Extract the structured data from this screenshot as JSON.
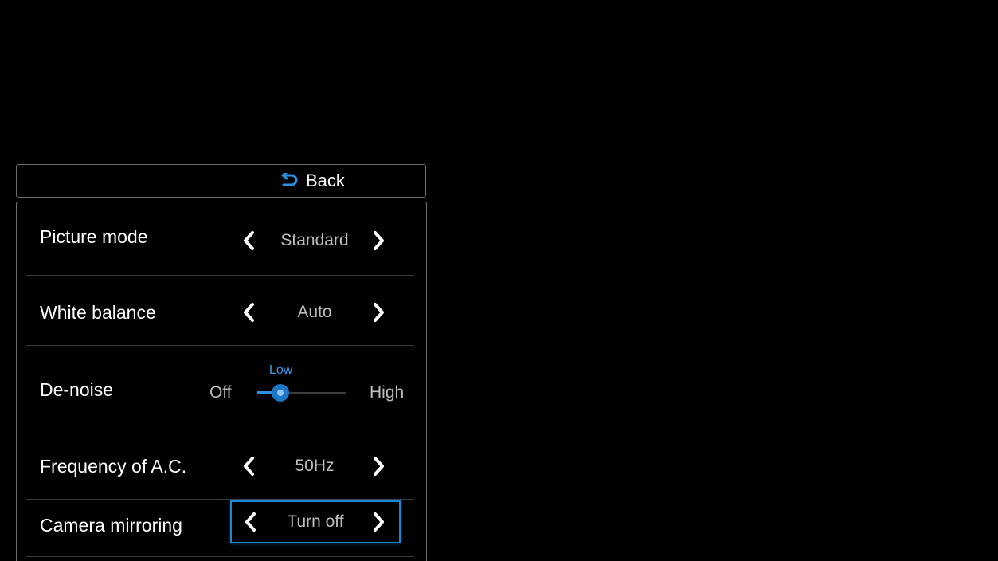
{
  "theme": {
    "background": "#000000",
    "accent": "#1f88d6",
    "text_primary": "#ffffff",
    "text_value": "#bdbdbd",
    "border": "#6e6e6e"
  },
  "back": {
    "label": "Back",
    "icon": "back-arrow-icon"
  },
  "settings": {
    "picture_mode": {
      "label": "Picture mode",
      "value": "Standard",
      "left_icon": "chevron-left-icon",
      "right_icon": "chevron-right-icon"
    },
    "white_balance": {
      "label": "White balance",
      "value": "Auto",
      "left_icon": "chevron-left-icon",
      "right_icon": "chevron-right-icon"
    },
    "de_noise": {
      "label": "De-noise",
      "min_label": "Off",
      "max_label": "High",
      "level_label": "Low",
      "level_index": 1,
      "level_count": 3
    },
    "frequency_ac": {
      "label": "Frequency of A.C.",
      "value": "50Hz",
      "left_icon": "chevron-left-icon",
      "right_icon": "chevron-right-icon"
    },
    "camera_mirroring": {
      "label": "Camera mirroring",
      "value": "Turn off",
      "focused": true,
      "left_icon": "chevron-left-icon",
      "right_icon": "chevron-right-icon"
    }
  }
}
